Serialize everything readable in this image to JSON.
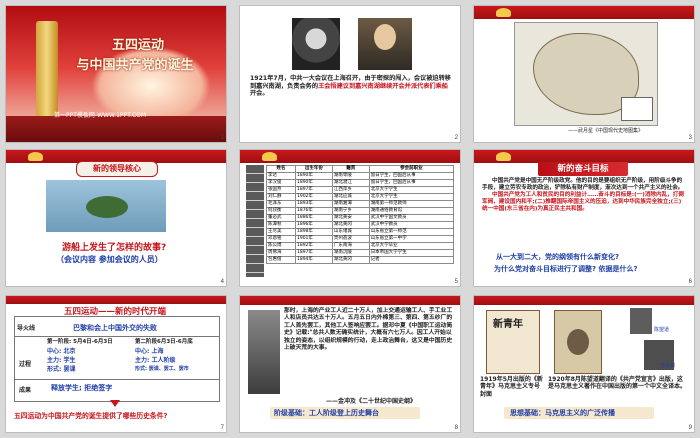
{
  "slides": [
    {
      "num": "1",
      "title_line1": "五四运动",
      "title_line2": "与中国共产党的诞生",
      "ppt_link": "第一PPT模板网-WWW.1PPT.COM"
    },
    {
      "num": "2",
      "paragraph_a": "1921年7月，中共一大会议在上海召开，由于密探的闯入，会议被迫转移到嘉兴南湖，负责会务的",
      "paragraph_highlight": "王会悟建议到嘉兴南湖继续开会并派代表们乘船",
      "paragraph_b": "开会。"
    },
    {
      "num": "3",
      "caption": "——武月星《中国现代史地图集》"
    },
    {
      "num": "4",
      "heading": "新的领导核心",
      "question": "游船上发生了怎样的故事?",
      "hint": "（会议内容  参加会议的人员）"
    },
    {
      "num": "5"
    },
    {
      "num": "6",
      "heading": "新的奋斗目标",
      "p1": "中国共产党是中国无产阶级政党。他的目的是要组织无产阶级，用阶级斗争的手段，建立劳农专政的政治，铲除私有财产制度，渐次达到一个共产主义的社会。",
      "p2": "中国共产党为工人和贫民的目的利益计……奋斗的目标是:(一)消除内乱，打倒军阀，建设国内和平;(二)推翻国际帝国主义的压迫，达到中华民族完全独立;(三)统一中国(东三省在内)为真正民主共和国。",
      "q1": "从一大到二大，党的纲领有什么新变化?",
      "q2": "为什么党对奋斗目标进行了调整? 依据是什么?"
    },
    {
      "num": "7",
      "title": "五四运动——新的时代开端",
      "row1_label": "导火线",
      "row1_value": "巴黎和会上中国外交的失败",
      "row2_label": "过程",
      "stage1_header": "第一阶段: 5月4日-6月3日",
      "stage1_center": "中心: 北京",
      "stage1_main": "主力: 学生",
      "stage1_form": "形式: 罢课",
      "stage2_header": "第二阶段6月3日-6月底",
      "stage2_center": "中心: 上海",
      "stage2_main": "主力: 工人阶级",
      "stage2_form": "形式: 罢课、罢工、罢市",
      "row3_label": "成果",
      "row3_value": "释放学生; 拒绝签字",
      "question": "五四运动为中国共产党的诞生提供了哪些历史条件?"
    },
    {
      "num": "8",
      "paragraph": "那时，上海的产业工人近二十万人，加上交通运输工人、手工业工人和店员共达五十万人。五月五日内外棉第三、第四、第五纱厂的工人首先罢工，其他工人签响应罢工。据邓中夏《中国职工运动简史》记载:\"总共人数无确实统计，大概有六七万人。因工人开始以独立的姿态，以组织规模的行动，走上政治舞台，这又是中国历史上破天荒的大事。",
      "source": "——金冲及《二十世纪中国史纲》",
      "band": "阶级基础：工人阶级登上历史舞台"
    },
    {
      "num": "9",
      "cover_title": "新青年",
      "caption_a": "1919年5月出版的《新青年》马克思主义专号封面",
      "caption_b": "1920年8月陈望道翻译的《共产党宣言》出版，这是马克思主义著作在中国出版的第一个中文全译本。",
      "band": "思想基础：马克思主义的广泛传播",
      "portrait_label_1": "陈望道",
      "portrait_label_2": "李大钊"
    }
  ],
  "table_rows": [
    [
      "李达",
      "1890年",
      "湖南零陵",
      "留日学生，回国后从事"
    ],
    [
      "李汉俊",
      "1890年",
      "湖北潜江",
      "留日学生，回国后从事"
    ],
    [
      "张国焘",
      "1897年",
      "江西萍乡",
      "北京大学学生"
    ],
    [
      "刘仁静",
      "1902年",
      "湖北应城",
      "北京大学学生"
    ],
    [
      "毛泽东",
      "1893年",
      "湖南湘潭",
      "湖南第一师范教师"
    ],
    [
      "何叔衡",
      "1876年",
      "湖南宁乡",
      "湖南通俗教育馆"
    ],
    [
      "董必武",
      "1886年",
      "湖北黄安",
      "武汉中学国文教员"
    ],
    [
      "陈潭秋",
      "1896年",
      "湖北黄冈",
      "武汉中学教员"
    ],
    [
      "王尽美",
      "1898年",
      "山东诸城",
      "山东省立第一师范"
    ],
    [
      "邓恩铭",
      "1901年",
      "贵州荔波",
      "山东省立第一中学"
    ],
    [
      "陈公博",
      "1892年",
      "广东南海",
      "北京大学毕业"
    ],
    [
      "周佛海",
      "1897年",
      "湖南沅陵",
      "日本帝国大学学生"
    ],
    [
      "包惠僧",
      "1894年",
      "湖北黄冈",
      "记者"
    ]
  ],
  "table_headers": [
    "姓名",
    "出生年份",
    "籍贯",
    "参会前职业"
  ],
  "colors": {
    "accent": "#c8161d",
    "text_blue": "#1f3fa6",
    "background": "#d9d9d9"
  }
}
